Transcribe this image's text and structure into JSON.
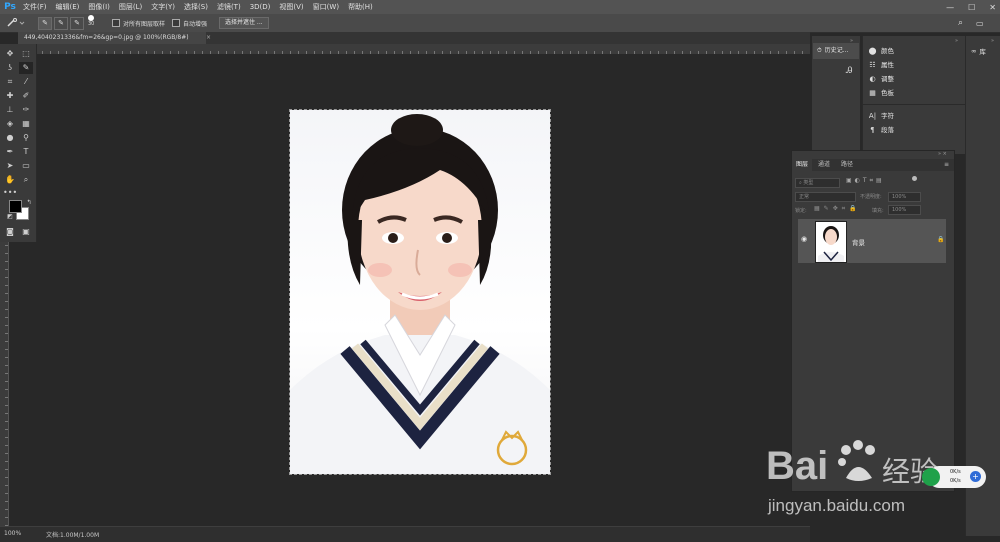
{
  "app": {
    "logo": "Ps"
  },
  "menu": [
    "文件(F)",
    "编辑(E)",
    "图像(I)",
    "图层(L)",
    "文字(Y)",
    "选择(S)",
    "滤镜(T)",
    "3D(D)",
    "视图(V)",
    "窗口(W)",
    "帮助(H)"
  ],
  "options": {
    "brush_size": "30",
    "sample_all_layers": "对所有图层取样",
    "auto_enhance": "自动增强",
    "select_mask_button": "选择并遮住 ..."
  },
  "document": {
    "tab_title": "449,4040231336&fm=26&gp=0.jpg @ 100%(RGB/8#)",
    "zoom": "100%",
    "doc_info": "文档:1.00M/1.00M"
  },
  "panels": {
    "history": "历史记...",
    "side_items": [
      {
        "icon": "color-icon",
        "label": "颜色"
      },
      {
        "icon": "properties-icon",
        "label": "属性"
      },
      {
        "icon": "adjustments-icon",
        "label": "调整"
      },
      {
        "icon": "swatches-icon",
        "label": "色板"
      },
      {
        "icon": "character-icon",
        "label": "字符"
      },
      {
        "icon": "paragraph-icon",
        "label": "段落"
      }
    ],
    "libraries": "库"
  },
  "layers": {
    "tabs": [
      "图层",
      "通道",
      "路径"
    ],
    "filter_label": "类型",
    "blend_mode": "正常",
    "opacity_label": "不透明度:",
    "opacity_value": "100%",
    "lock_label": "锁定:",
    "fill_label": "填充:",
    "fill_value": "100%",
    "layer_name": "背景"
  },
  "watermark": {
    "brand": "Bai",
    "brand_cn": "经验",
    "url": "jingyan.baidu.com"
  },
  "network": {
    "up": "0K/s",
    "down": "0K/s"
  },
  "colors": {
    "ps_blue": "#31a8ff",
    "baidu_blue": "#2932e1",
    "watermark": "#d8d8d8"
  }
}
